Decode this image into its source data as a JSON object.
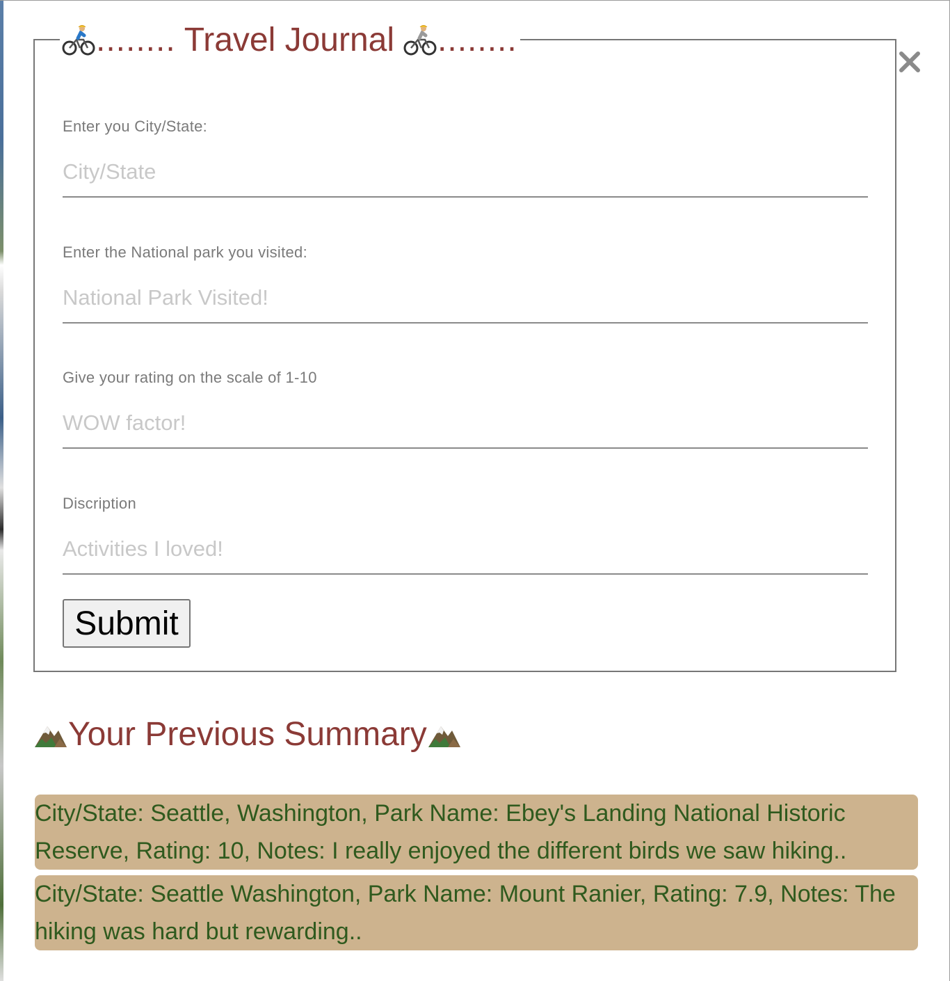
{
  "journal": {
    "title": "Travel Journal",
    "dots_left": "........",
    "dots_right": "........",
    "fields": [
      {
        "label": "Enter you City/State:",
        "placeholder": "City/State",
        "value": ""
      },
      {
        "label": "Enter the National park you visited:",
        "placeholder": "National Park Visited!",
        "value": ""
      },
      {
        "label": "Give your rating on the scale of 1-10",
        "placeholder": "WOW factor!",
        "value": ""
      },
      {
        "label": "Discription",
        "placeholder": "Activities I loved!",
        "value": ""
      }
    ],
    "submit_label": "Submit",
    "close_label": "×"
  },
  "summary": {
    "heading": "Your Previous Summary",
    "entries": [
      "City/State: Seattle, Washington, Park Name: Ebey's Landing National Historic Reserve, Rating: 10, Notes: I really enjoyed the different birds we saw hiking..",
      "City/State: Seattle Washington, Park Name: Mount Ranier, Rating: 7.9, Notes: The hiking was hard but rewarding.."
    ]
  },
  "colors": {
    "heading": "#8b3a36",
    "entry_bg": "#cdb38e",
    "entry_text": "#2f5a1e",
    "label": "#7a7a7a",
    "placeholder": "#c8c8c8"
  },
  "icons": {
    "legend_left": "cyclist-icon",
    "legend_right": "cyclist-icon",
    "summary_left": "mountain-icon",
    "summary_right": "mountain-icon",
    "close": "close-icon"
  }
}
